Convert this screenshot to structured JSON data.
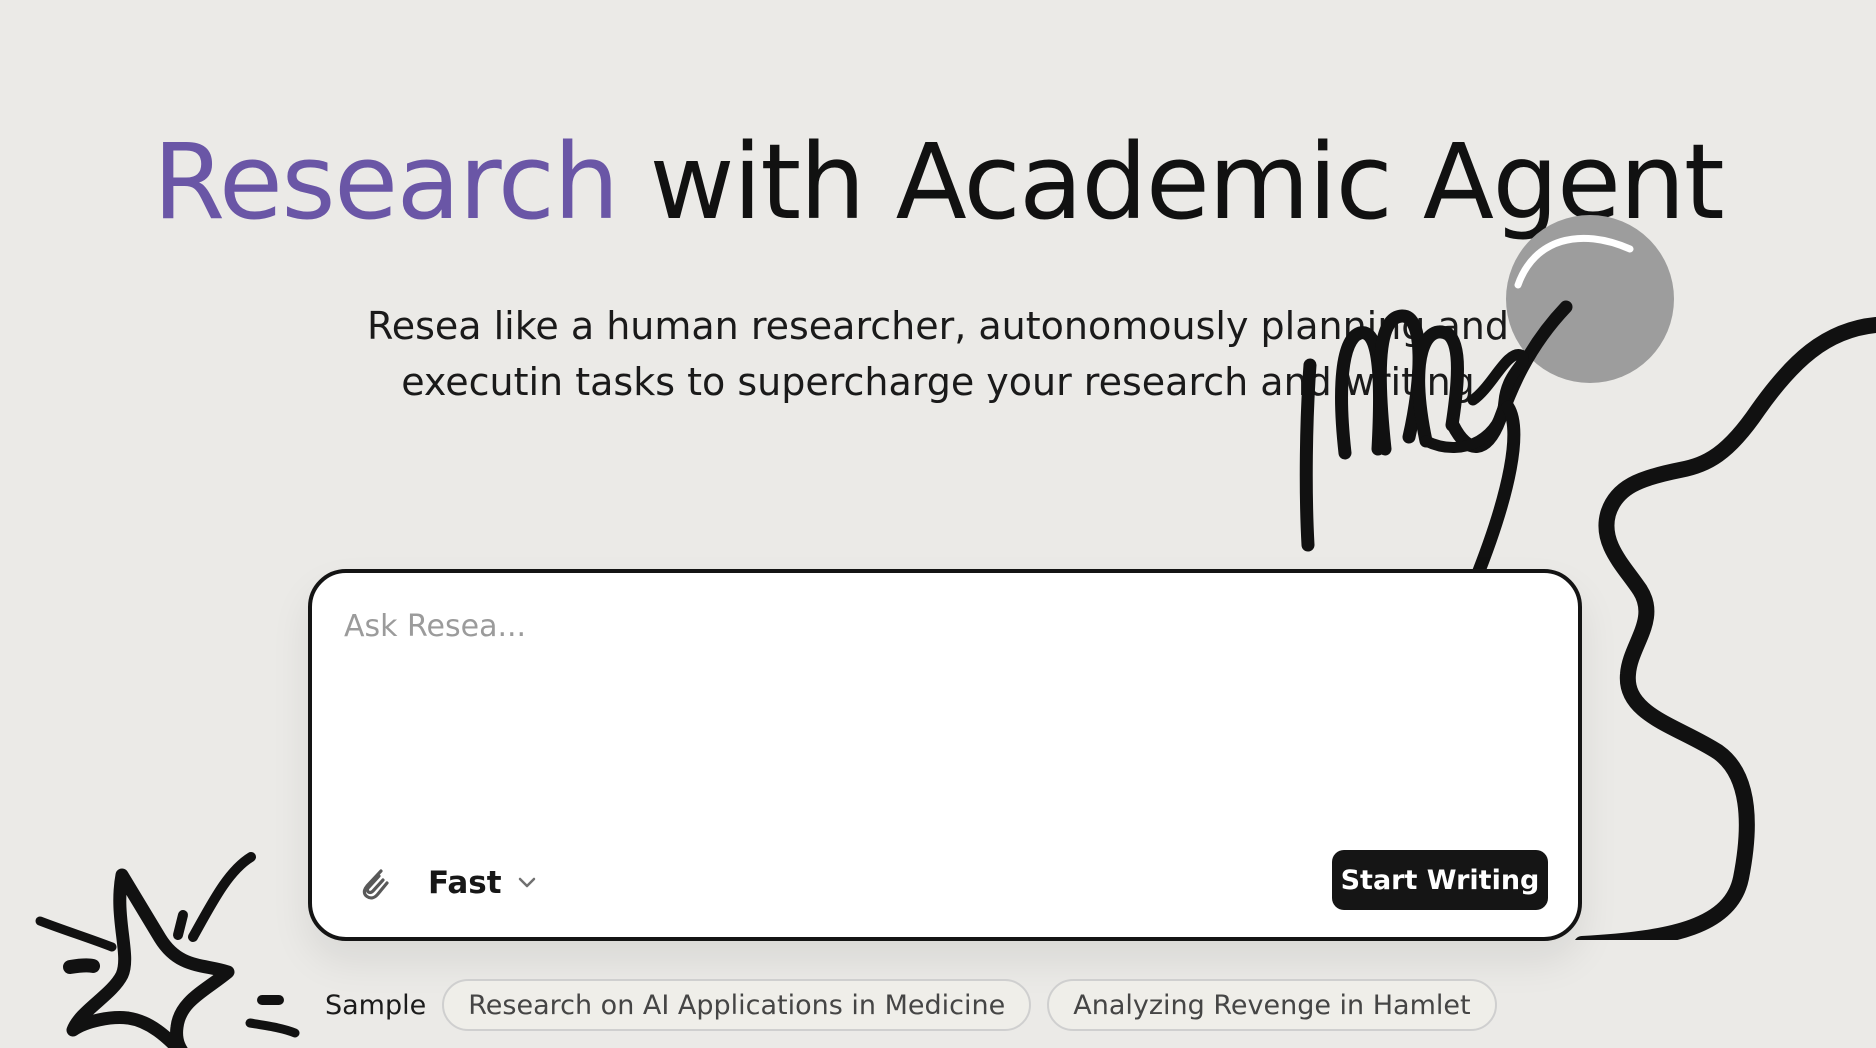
{
  "hero": {
    "title_accent": "Research",
    "title_rest": " with Academic Agent",
    "subtitle_line1": "Resea like a human researcher, autonomously planning and",
    "subtitle_line2": "executin tasks to supercharge your research and writing"
  },
  "composer": {
    "placeholder": "Ask Resea...",
    "mode": "Fast",
    "start_label": "Start Writing"
  },
  "samples": {
    "label": "Sample",
    "items": [
      "Research on AI Applications in Medicine",
      "Analyzing Revenge in Hamlet"
    ]
  },
  "icons": {
    "attach": "paperclip-icon",
    "dropdown": "chevron-down-icon",
    "hand": "hand-pointing-icon",
    "squiggle": "squiggle-line-icon",
    "star": "sparkle-star-icon"
  },
  "colors": {
    "background": "#ebeae7",
    "accent": "#6a56a6",
    "dark": "#151515",
    "chip_border": "#cfcfcf"
  }
}
